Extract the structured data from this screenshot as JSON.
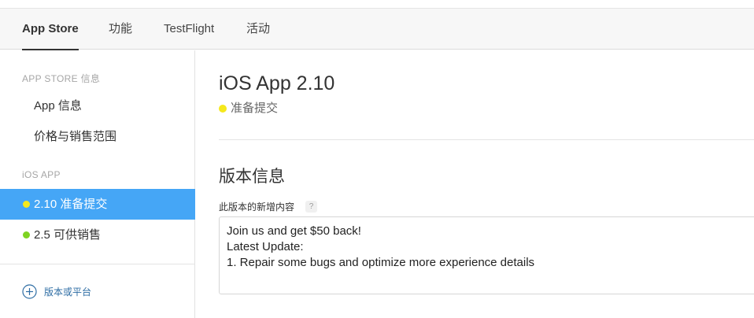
{
  "tabs": [
    {
      "label": "App Store",
      "active": true
    },
    {
      "label": "功能",
      "active": false
    },
    {
      "label": "TestFlight",
      "active": false
    },
    {
      "label": "活动",
      "active": false
    }
  ],
  "sidebar": {
    "section_appstore": "APP STORE 信息",
    "items_appstore": [
      {
        "label": "App 信息"
      },
      {
        "label": "价格与销售范围"
      }
    ],
    "section_ios": "iOS APP",
    "versions": [
      {
        "label": "2.10 准备提交",
        "status_color": "#f5e81c",
        "selected": true
      },
      {
        "label": "2.5 可供销售",
        "status_color": "#7ed321",
        "selected": false
      }
    ],
    "add_label": "版本或平台",
    "add_icon": "plus-circle-icon"
  },
  "main": {
    "app_title": "iOS App 2.10",
    "status": {
      "label": "准备提交",
      "color": "#f5e81c"
    },
    "section_title": "版本信息",
    "whats_new_label": "此版本的新增内容",
    "help_icon_glyph": "?",
    "whats_new_lines": [
      "Join us and get $50 back!",
      "Latest Update:",
      "1. Repair some bugs and optimize more experience details"
    ]
  },
  "colors": {
    "accent": "#45a6f6",
    "link": "#2e6da4"
  }
}
